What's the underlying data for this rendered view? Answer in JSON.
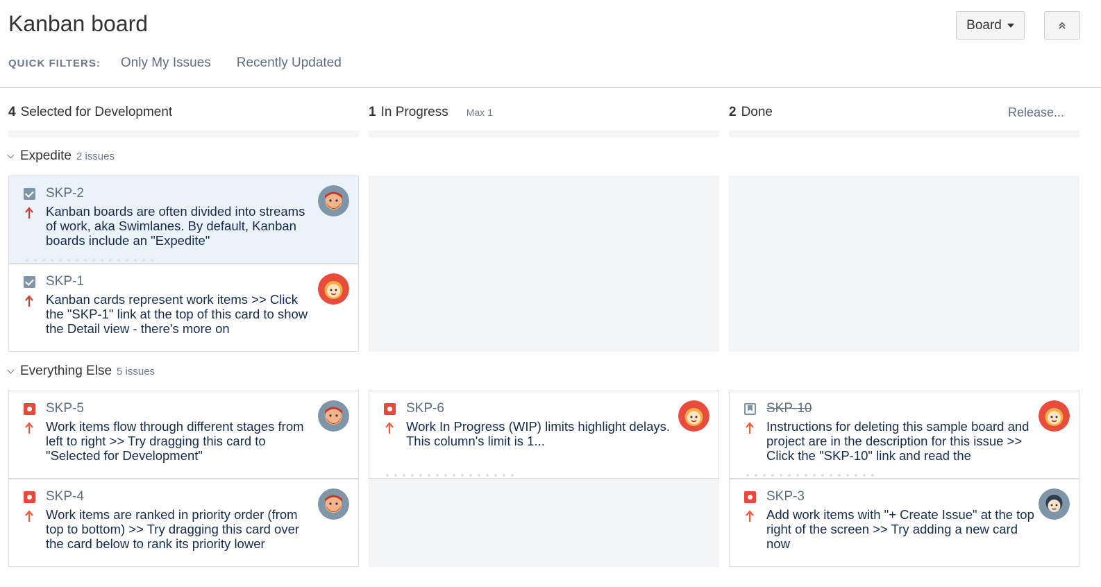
{
  "header": {
    "title": "Kanban board",
    "board_button": "Board",
    "quick_filters_label": "QUICK FILTERS:",
    "quick_filters": [
      "Only My Issues",
      "Recently Updated"
    ]
  },
  "columns": [
    {
      "count": "4",
      "name": "Selected for Development",
      "max": ""
    },
    {
      "count": "1",
      "name": "In Progress",
      "max": "Max 1"
    },
    {
      "count": "2",
      "name": "Done",
      "max": ""
    }
  ],
  "release_link": "Release...",
  "swimlanes": [
    {
      "name": "Expedite",
      "count": "2 issues",
      "cards": [
        {
          "key": "SKP-2",
          "summary": "Kanban boards are often divided into streams of work, aka Swimlanes. By default, Kanban boards include an \"Expedite\"",
          "type": "task",
          "priority_color": "#d04437",
          "avatar": "man-beard"
        },
        {
          "key": "SKP-1",
          "summary": "Kanban cards represent work items >> Click the \"SKP-1\" link at the top of this card to show the Detail view - there's more on",
          "type": "task",
          "priority_color": "#d04437",
          "avatar": "woman-blonde"
        }
      ]
    },
    {
      "name": "Everything Else",
      "count": "5 issues",
      "cards": [
        {
          "key": "SKP-5",
          "summary": "Work items flow through different stages from left to right >> Try dragging this card to \"Selected for Development\"",
          "type": "bug",
          "priority_color": "#f15c3c",
          "avatar": "man-beard"
        },
        {
          "key": "SKP-4",
          "summary": "Work items are ranked in priority order (from top to bottom) >> Try dragging this card over the card below to rank its priority lower",
          "type": "bug",
          "priority_color": "#f15c3c",
          "avatar": "man-beard"
        },
        {
          "key": "SKP-6",
          "summary": "Work In Progress (WIP) limits highlight delays. This column's limit is 1...",
          "type": "bug",
          "priority_color": "#f15c3c",
          "avatar": "woman-blonde"
        },
        {
          "key": "SKP-10",
          "summary": "Instructions for deleting this sample board and project are in the description for this issue >> Click the \"SKP-10\" link and read the",
          "type": "story",
          "priority_color": "#f15c3c",
          "avatar": "woman-blonde"
        },
        {
          "key": "SKP-3",
          "summary": "Add work items with \"+ Create Issue\" at the top right of the screen >> Try adding a new card now",
          "type": "bug",
          "priority_color": "#f15c3c",
          "avatar": "woman-dark"
        }
      ]
    }
  ]
}
